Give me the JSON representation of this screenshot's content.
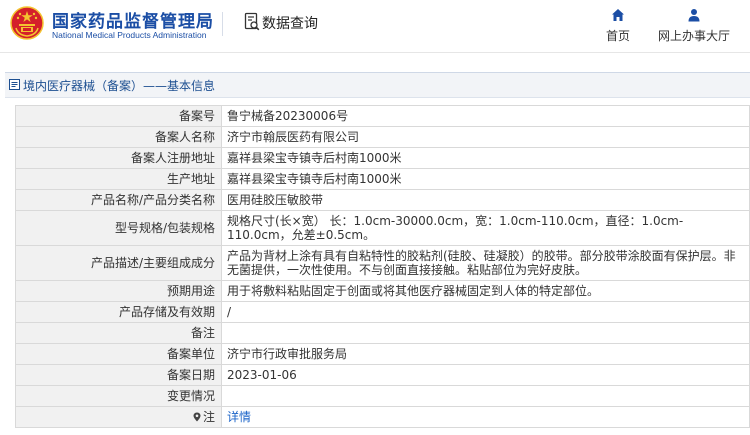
{
  "header": {
    "org_name": "国家药品监督管理局",
    "org_name_en": "National Medical Products Administration",
    "query_title": "数据查询",
    "nav": [
      {
        "label": "首页",
        "icon": "home-icon"
      },
      {
        "label": "网上办事大厅",
        "icon": "user-icon"
      }
    ]
  },
  "breadcrumb": {
    "text": "境内医疗器械（备案）——基本信息"
  },
  "record": {
    "rows": [
      {
        "label": "备案号",
        "value": "鲁宁械备20230006号"
      },
      {
        "label": "备案人名称",
        "value": "济宁市翰辰医药有限公司"
      },
      {
        "label": "备案人注册地址",
        "value": "嘉祥县梁宝寺镇寺后村南1000米"
      },
      {
        "label": "生产地址",
        "value": "嘉祥县梁宝寺镇寺后村南1000米"
      },
      {
        "label": "产品名称/产品分类名称",
        "value": "医用硅胶压敏胶带"
      },
      {
        "label": "型号规格/包装规格",
        "value": "规格尺寸(长×宽）  长：1.0cm-30000.0cm，宽：1.0cm-110.0cm，直径：1.0cm-110.0cm，允差±0.5cm。"
      },
      {
        "label": "产品描述/主要组成成分",
        "value": "产品为背材上涂有具有自粘特性的胶粘剂(硅胶、硅凝胶）的胶带。部分胶带涂胶面有保护层。非无菌提供，一次性使用。不与创面直接接触。粘贴部位为完好皮肤。"
      },
      {
        "label": "预期用途",
        "value": "用于将敷料粘贴固定于创面或将其他医疗器械固定到人体的特定部位。"
      },
      {
        "label": "产品存储及有效期",
        "value": "/"
      },
      {
        "label": "备注",
        "value": ""
      },
      {
        "label": "备案单位",
        "value": "济宁市行政审批服务局"
      },
      {
        "label": "备案日期",
        "value": "2023-01-06"
      },
      {
        "label": "变更情况",
        "value": ""
      },
      {
        "label": "注",
        "value": "详情"
      }
    ]
  },
  "colors": {
    "brand_blue": "#1b4ea5",
    "emblem_red": "#d4202a",
    "emblem_gold": "#f4c430",
    "link_blue": "#1a63c8",
    "label_bg": "#f1f1f1"
  }
}
